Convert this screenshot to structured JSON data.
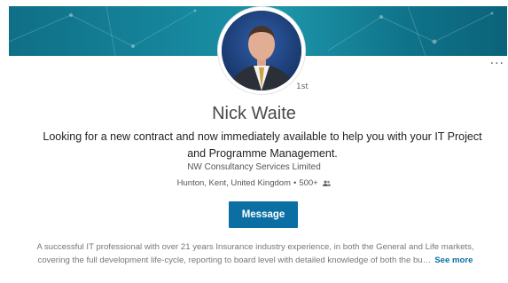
{
  "profile": {
    "name": "Nick Waite",
    "degree": "1st",
    "headline": "Looking for a new contract and now immediately available to help you with your IT Project and Programme Management.",
    "company": "NW Consultancy Services Limited",
    "location": "Hunton, Kent, United Kingdom",
    "separator": "•",
    "connections": "500+",
    "connections_icon": "people-icon"
  },
  "actions": {
    "message_label": "Message",
    "more_label": "···"
  },
  "summary": {
    "line1": "A successful IT professional with over 21 years Insurance industry experience, in both the General and Life markets,",
    "line2": "covering the full development life-cycle, reporting to board level with detailed knowledge of both the bu…",
    "see_more": "See more"
  },
  "colors": {
    "banner": "#127e95",
    "accent": "#0b6fa4"
  }
}
